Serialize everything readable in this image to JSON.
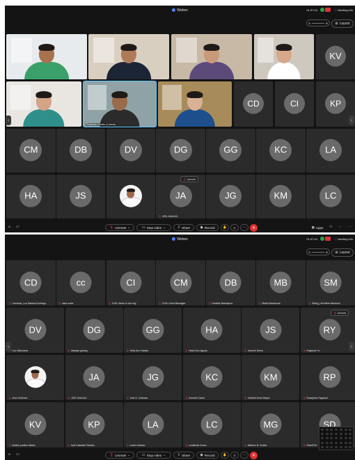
{
  "app": {
    "title": "Webex",
    "layout_label": "Layout",
    "meeting_info": "Meeting info"
  },
  "top": {
    "clock": "01:57:16",
    "video_tiles": [
      {
        "id": "v1",
        "skin": "#a9724f",
        "shirt": "#3aa06a",
        "bg": "#e7ebee"
      },
      {
        "id": "v2",
        "skin": "#b07a58",
        "shirt": "#1c2536",
        "bg": "#d9cfc1"
      },
      {
        "id": "v3",
        "skin": "#c99a7a",
        "shirt": "#5b4a7a",
        "bg": "#c7b9a6"
      },
      {
        "id": "v4",
        "skin": "#d7a88a",
        "shirt": "#ffffff",
        "bg": "#cfc8bf"
      },
      {
        "id": "v5",
        "skin": "#d3a487",
        "shirt": "#2f8f8a",
        "bg": "#e9e6e2"
      },
      {
        "id": "v6",
        "skin": "#9a6a4a",
        "shirt": "#2b2b2b",
        "bg": "#8fa3a7",
        "label": "Research Center (Cobest)"
      },
      {
        "id": "v7",
        "skin": "#d8b197",
        "shirt": "#1d4f8c",
        "bg": "#a88b5a"
      }
    ],
    "initial_row2": [
      "KV"
    ],
    "initial_row2b": [
      "CD",
      "CI",
      "KP"
    ],
    "initial_row3": [
      "CM",
      "DB",
      "DV",
      "DG",
      "GG",
      "KC",
      "LA"
    ],
    "initial_row4": [
      "HA",
      "JS",
      "",
      "JA",
      "JG",
      "KM",
      "LC"
    ],
    "row4_name_ja": "JOEL ANAJAO",
    "unmute_pill": "Unmute"
  },
  "bottom": {
    "clock": "01:57:04",
    "rows": [
      [
        {
          "i": "CD",
          "n": "Carmona_Lou Marissa Domingo"
        },
        {
          "i": "cc",
          "n": "clark costa"
        },
        {
          "i": "CI",
          "n": "CvSU Ninia Jo Ann Ing"
        },
        {
          "i": "CM",
          "n": "CvSU Jonel Manalgan"
        },
        {
          "i": "DB",
          "n": "Danielle Barbajeros"
        },
        {
          "i": "MB",
          "n": "Martin Barbarona"
        },
        {
          "i": "SM",
          "n": "Siblog_Hermiline Mendoza"
        }
      ],
      [
        {
          "i": "DV",
          "n": "Uno Villanueva"
        },
        {
          "i": "DG",
          "n": "divaelyn galang"
        },
        {
          "i": "GG",
          "n": "Gelly Ann Gulada"
        },
        {
          "i": "HA",
          "n": "Hazel Ann Aguzar"
        },
        {
          "i": "JS",
          "n": "Jeramel Sierra"
        },
        {
          "i": "RY",
          "n": "Rogelyne Yu"
        }
      ],
      [
        {
          "i": "",
          "n": "Jhun Gutierrez"
        },
        {
          "i": "JA",
          "n": "JOEL ANAJAO"
        },
        {
          "i": "JG",
          "n": "Julie G. Guevara"
        },
        {
          "i": "KC",
          "n": "Kenneth Catha"
        },
        {
          "i": "KM",
          "n": "Kristelle Anne Mayao"
        },
        {
          "i": "RP",
          "n": "Rosalynne Pagaduri"
        }
      ],
      [
        {
          "i": "KV",
          "n": "kristine pauline villarin"
        },
        {
          "i": "KP",
          "n": "Kyle Kassella Paredes"
        },
        {
          "i": "LA",
          "n": "Lester Adriano"
        },
        {
          "i": "LC",
          "n": "Lenalinda Clores"
        },
        {
          "i": "MG",
          "n": "Marlene B. Gralha"
        },
        {
          "i": "SD",
          "n": "Sheriff Du"
        }
      ]
    ],
    "unmute_pill": "Unmute"
  },
  "controls": {
    "unmute": "Unmute",
    "stop_video": "Stop video",
    "share": "Share",
    "record": "Record",
    "apps": "Apps"
  },
  "colors": {
    "panel_bg": "#141414",
    "tile_bg": "#2b2b2b",
    "avatar": "#6a6a6a",
    "end_red": "#e0302f",
    "speaker_outline": "#5ec8ff"
  }
}
